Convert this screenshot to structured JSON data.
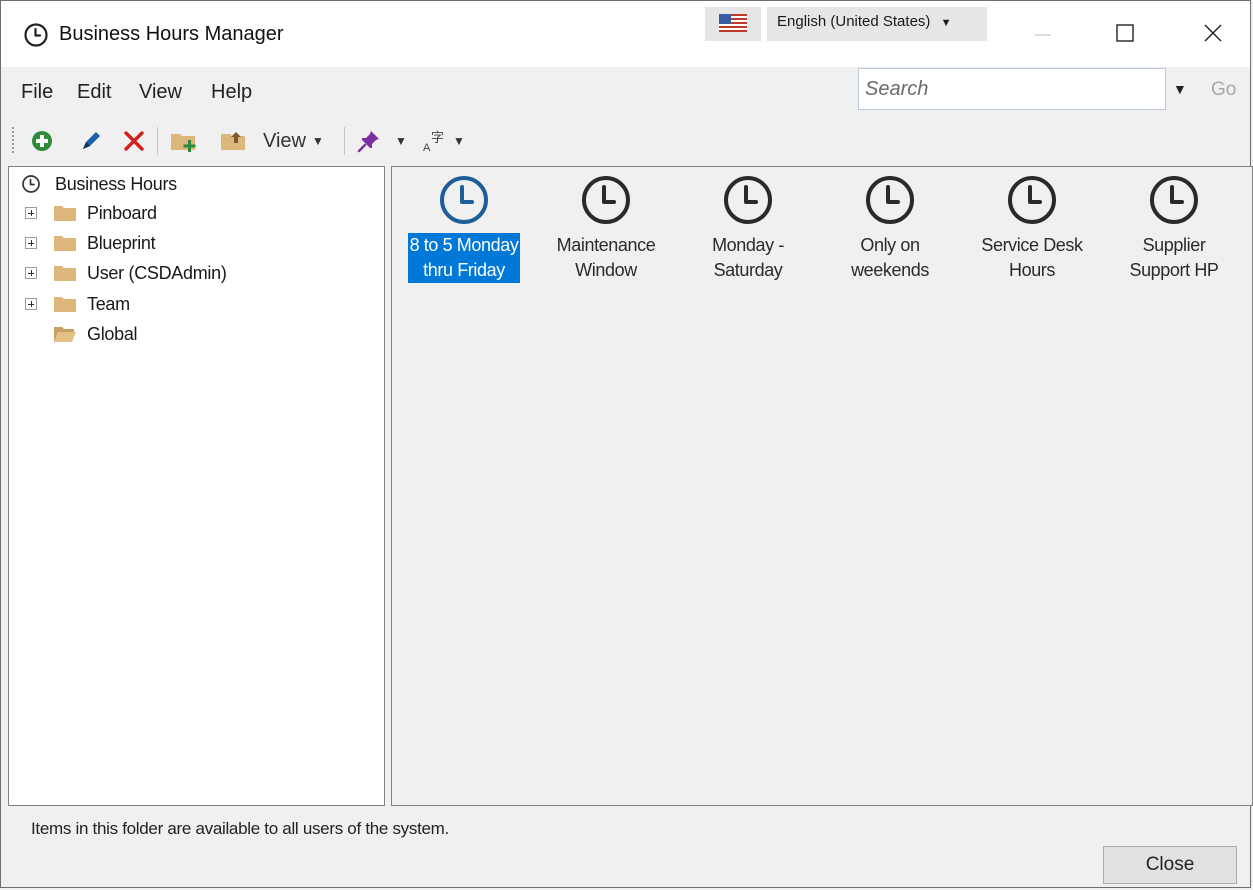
{
  "window": {
    "title": "Business Hours Manager",
    "language": "English (United States)"
  },
  "menu": {
    "file": "File",
    "edit": "Edit",
    "view": "View",
    "help": "Help"
  },
  "search": {
    "placeholder": "Search",
    "go_label": "Go"
  },
  "toolbar": {
    "view_label": "View"
  },
  "tree": {
    "root_label": "Business Hours",
    "items": [
      {
        "label": "Pinboard"
      },
      {
        "label": "Blueprint"
      },
      {
        "label": "User (CSDAdmin)"
      },
      {
        "label": "Team"
      },
      {
        "label": "Global"
      }
    ]
  },
  "tiles": [
    {
      "line1": "8 to 5 Monday",
      "line2": "thru Friday"
    },
    {
      "line1": "Maintenance",
      "line2": "Window"
    },
    {
      "line1": "Monday -",
      "line2": "Saturday"
    },
    {
      "line1": "Only on",
      "line2": "weekends"
    },
    {
      "line1": "Service Desk",
      "line2": "Hours"
    },
    {
      "line1": "Supplier",
      "line2": "Support HP"
    }
  ],
  "status": {
    "text": "Items in this folder are available to all users of the system."
  },
  "buttons": {
    "close_label": "Close"
  },
  "colors": {
    "selection": "#0078d7",
    "folder": "#dcb67a",
    "add_green": "#2e8b3a",
    "delete_red": "#d21f1f",
    "pin_purple": "#7b2fa0"
  }
}
